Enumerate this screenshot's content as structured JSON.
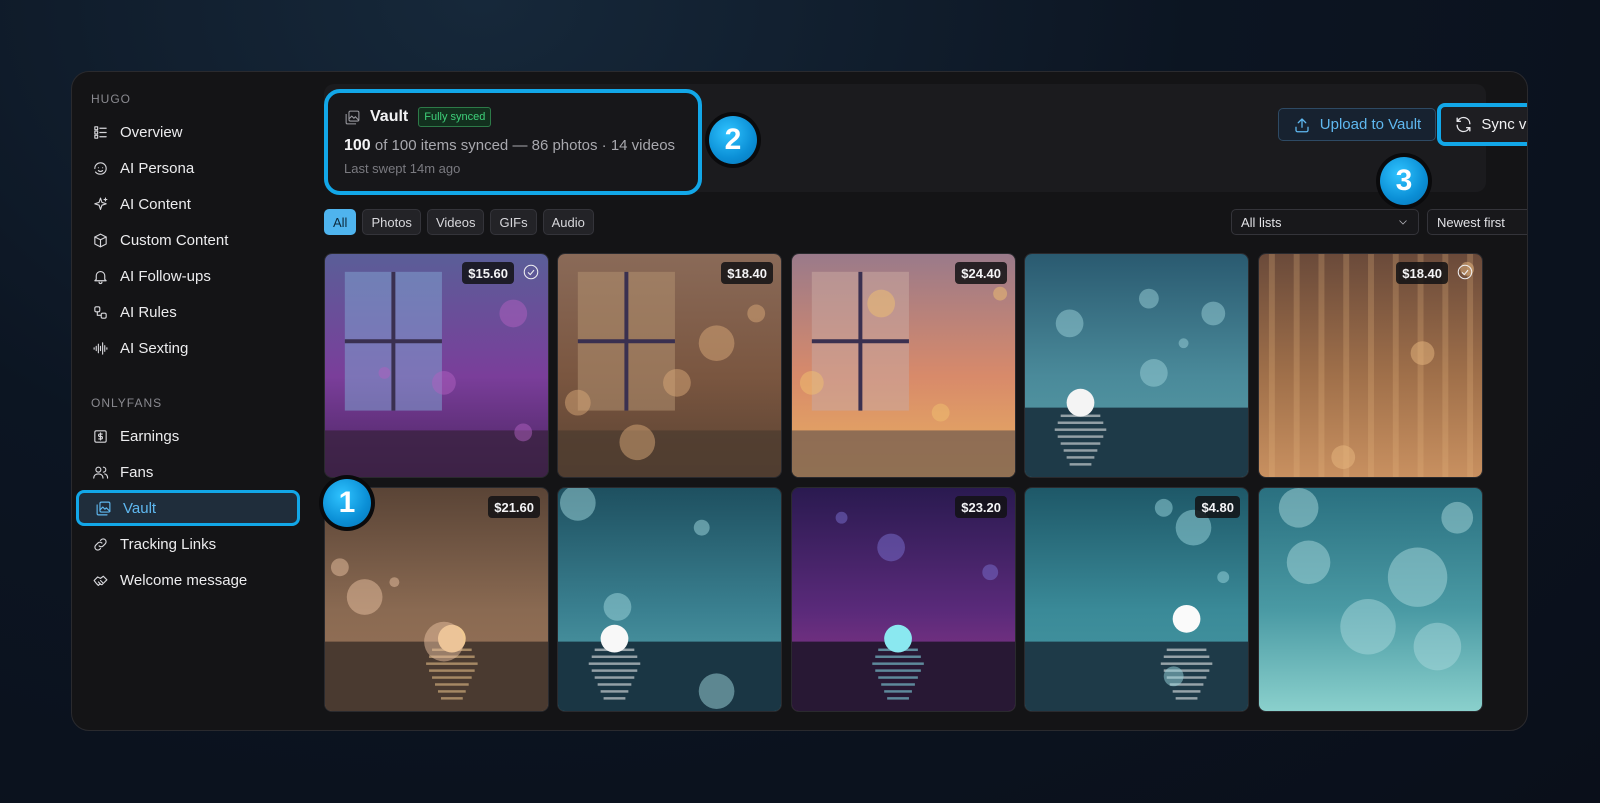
{
  "sidebar": {
    "section1": "HUGO",
    "items1": [
      {
        "label": "Overview",
        "icon": "overview-icon"
      },
      {
        "label": "AI Persona",
        "icon": "persona-icon"
      },
      {
        "label": "AI Content",
        "icon": "sparkle-icon"
      },
      {
        "label": "Custom Content",
        "icon": "box-icon"
      },
      {
        "label": "AI Follow-ups",
        "icon": "bell-icon"
      },
      {
        "label": "AI Rules",
        "icon": "rules-icon"
      },
      {
        "label": "AI Sexting",
        "icon": "waveform-icon"
      }
    ],
    "section2": "ONLYFANS",
    "items2": [
      {
        "label": "Earnings",
        "icon": "dollar-icon"
      },
      {
        "label": "Fans",
        "icon": "users-icon"
      },
      {
        "label": "Vault",
        "icon": "gallery-icon",
        "active": true
      },
      {
        "label": "Tracking Links",
        "icon": "link-icon"
      },
      {
        "label": "Welcome message",
        "icon": "handshake-icon"
      }
    ]
  },
  "vault": {
    "title": "Vault",
    "badge": "Fully synced",
    "synced_count": "100",
    "sync_text": " of 100 items synced — 86 photos · 14 videos",
    "last_swept": "Last swept 14m ago"
  },
  "actions": {
    "upload": "Upload to Vault",
    "sync": "Sync vault"
  },
  "markers": [
    "1",
    "2",
    "3"
  ],
  "filters": [
    {
      "label": "All",
      "active": true
    },
    {
      "label": "Photos"
    },
    {
      "label": "Videos"
    },
    {
      "label": "GIFs"
    },
    {
      "label": "Audio"
    }
  ],
  "selects": {
    "lists": "All lists",
    "sort": "Newest first"
  },
  "tiles": [
    {
      "price": "$15.60",
      "checked": true,
      "scene": "window-purple"
    },
    {
      "price": "$18.40",
      "checked": false,
      "scene": "window-brown"
    },
    {
      "price": "$24.40",
      "checked": false,
      "scene": "window-sunset"
    },
    {
      "price": "",
      "checked": false,
      "scene": "sea-teal"
    },
    {
      "price": "$18.40",
      "checked": true,
      "scene": "curtain-bronze"
    },
    {
      "price": "$21.60",
      "checked": false,
      "scene": "sea-brown"
    },
    {
      "price": "",
      "checked": false,
      "scene": "sea-teal2"
    },
    {
      "price": "$23.20",
      "checked": false,
      "scene": "sea-purple"
    },
    {
      "price": "$4.80",
      "checked": false,
      "scene": "sea-teal3"
    },
    {
      "price": "",
      "checked": false,
      "scene": "bokeh-teal"
    }
  ],
  "colors": {
    "accent": "#12a7e8",
    "link": "#5fb8f0",
    "badge_green": "#3ed07a"
  }
}
